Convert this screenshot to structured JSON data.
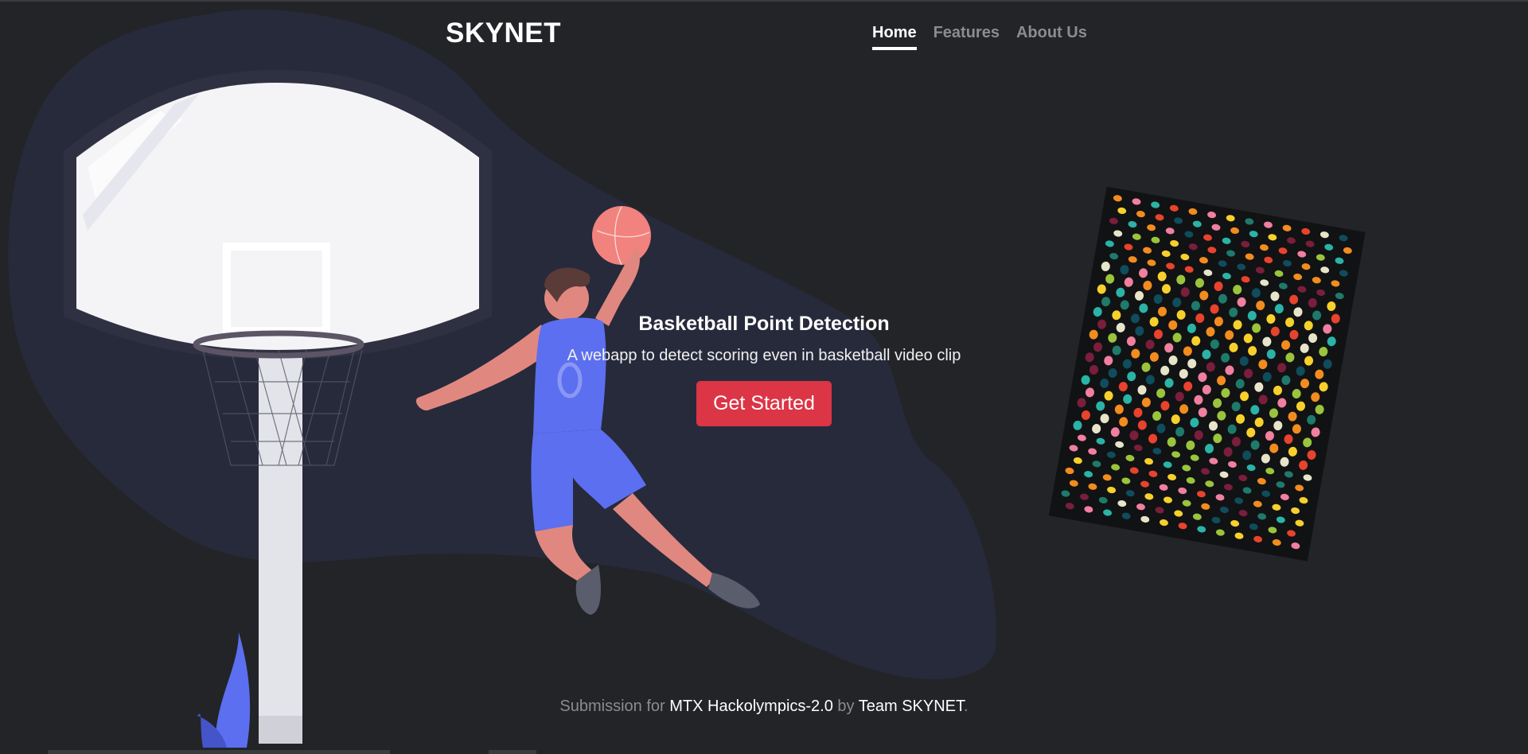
{
  "brand": "SKYNET",
  "nav": {
    "home": "Home",
    "features": "Features",
    "about": "About Us"
  },
  "hero": {
    "title": "Basketball Point Detection",
    "subtitle": "A webapp to detect scoring even in basketball video clip",
    "cta": "Get Started"
  },
  "footer": {
    "prefix": "Submission for ",
    "event": "MTX Hackolympics-2.0",
    "middle": " by ",
    "team": "Team SKYNET",
    "suffix": "."
  },
  "colors": {
    "background": "#222427",
    "blob": "#272a3b",
    "cta": "#dc3545",
    "player_jersey": "#5b6ff0",
    "ball": "#f2827e"
  },
  "icons": {
    "illustration": "basketball-player-illustration",
    "crowd": "stadium-crowd-graphic"
  }
}
